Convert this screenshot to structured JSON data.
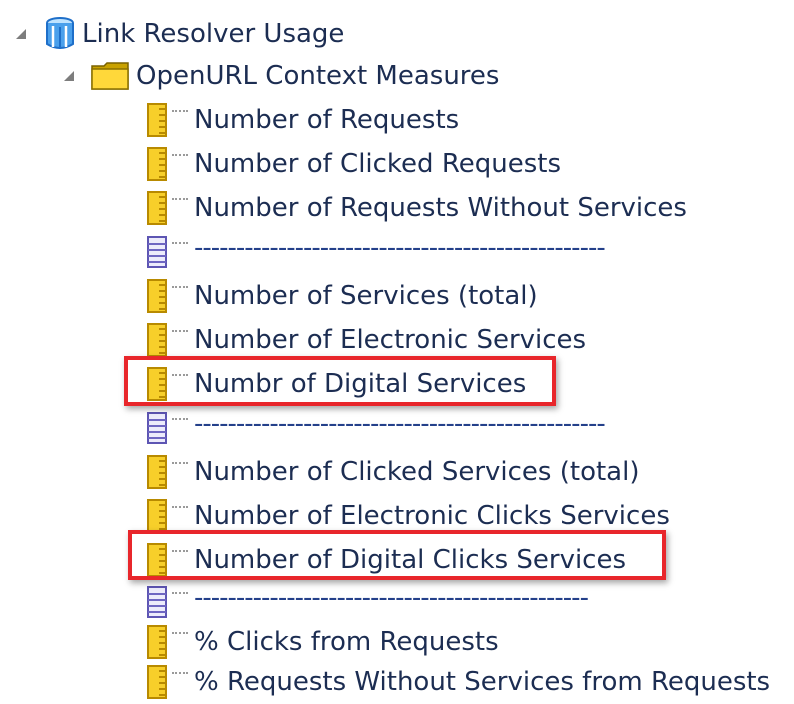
{
  "tree": {
    "root": {
      "label": "Link Resolver Usage",
      "icon": "subject-area-cube-icon",
      "expanded": true
    },
    "folder": {
      "label": "OpenURL Context Measures",
      "icon": "folder-icon",
      "expanded": true
    },
    "items": [
      {
        "label": "Number of Requests",
        "type": "measure"
      },
      {
        "label": "Number of Clicked Requests",
        "type": "measure"
      },
      {
        "label": "Number of Requests Without Services",
        "type": "measure"
      },
      {
        "label": "-------------------------------------------------",
        "type": "separator"
      },
      {
        "label": "Number of Services (total)",
        "type": "measure"
      },
      {
        "label": "Number of Electronic Services",
        "type": "measure"
      },
      {
        "label": "Numbr of Digital Services",
        "type": "measure",
        "highlighted": true
      },
      {
        "label": "-------------------------------------------------",
        "type": "separator"
      },
      {
        "label": "Number of Clicked Services (total)",
        "type": "measure"
      },
      {
        "label": "Number of Electronic Clicks Services",
        "type": "measure"
      },
      {
        "label": "Number of Digital Clicks Services",
        "type": "measure",
        "highlighted": true
      },
      {
        "label": "-----------------------------------------------",
        "type": "separator"
      },
      {
        "label": "% Clicks from Requests",
        "type": "measure"
      },
      {
        "label": "% Requests Without Services from Requests",
        "type": "measure"
      }
    ]
  },
  "colors": {
    "highlight": "#e8262b",
    "text": "#1c2d52",
    "measure_icon": "#f2c21b",
    "separator_icon": "#7b74c4"
  }
}
